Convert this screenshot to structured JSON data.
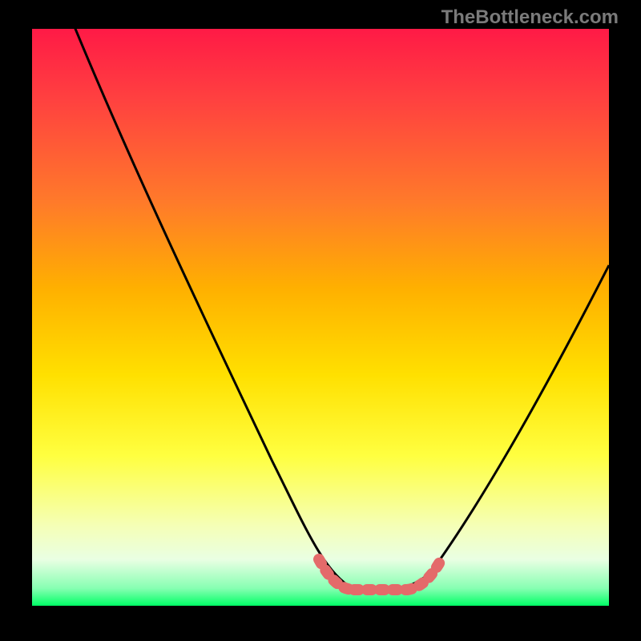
{
  "watermark": "TheBottleneck.com",
  "chart_data": {
    "type": "line",
    "title": "",
    "xlabel": "",
    "ylabel": "",
    "xlim": [
      0,
      100
    ],
    "ylim": [
      0,
      100
    ],
    "gradient_colors": {
      "top": "#ff1a46",
      "upper_mid": "#ff7a2a",
      "mid": "#ffe000",
      "lower_mid": "#ffff40",
      "bottom": "#00ff66"
    },
    "series": [
      {
        "name": "bottleneck-curve",
        "color": "#000000",
        "x": [
          7,
          14,
          22,
          30,
          38,
          46,
          51,
          55,
          60,
          64,
          69,
          76,
          84,
          92,
          100
        ],
        "y": [
          100,
          85,
          70,
          55,
          40,
          22,
          10,
          3,
          1,
          1,
          3,
          12,
          26,
          42,
          58
        ]
      },
      {
        "name": "optimal-band",
        "color": "#e46a6a",
        "x": [
          51,
          55,
          60,
          64,
          69
        ],
        "y": [
          10,
          3,
          1,
          1,
          3
        ]
      }
    ]
  }
}
